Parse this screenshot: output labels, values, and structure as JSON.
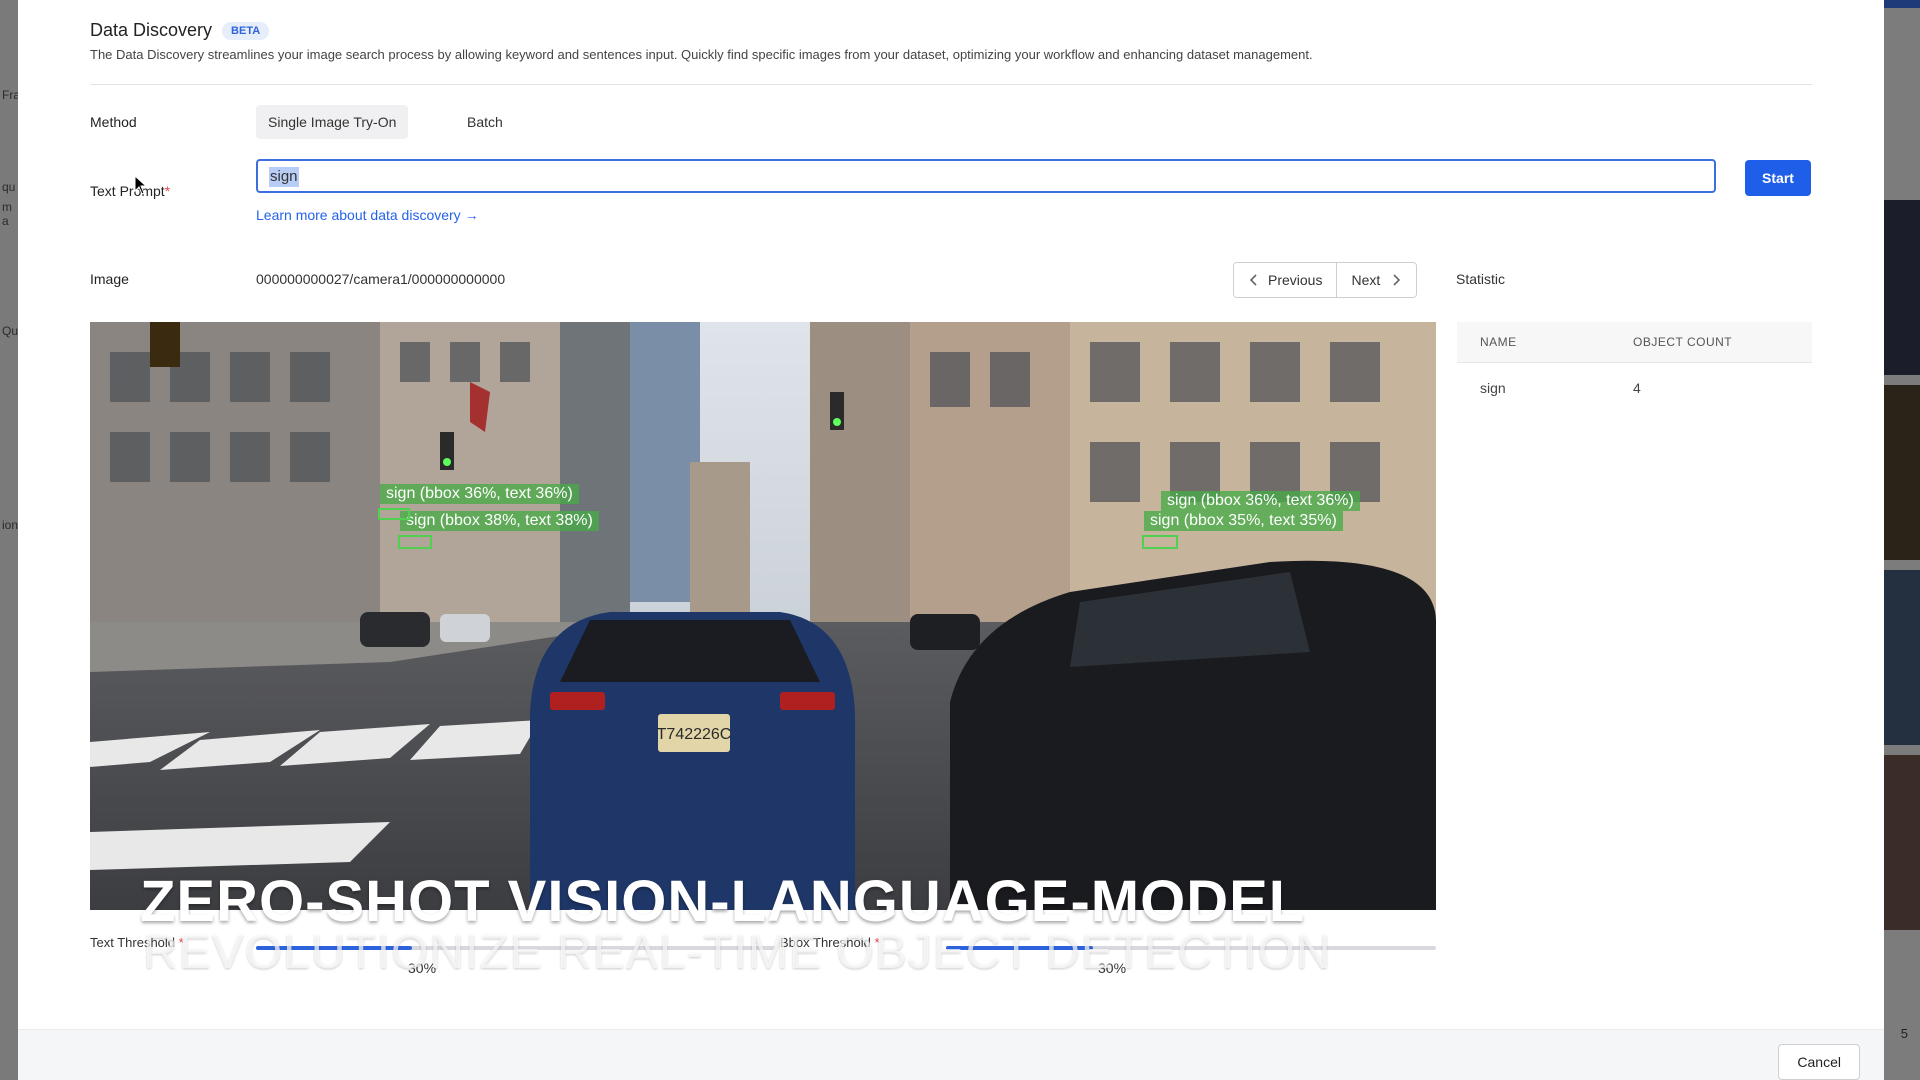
{
  "background": {
    "left_fragments": [
      "Fra",
      "qu",
      "m a",
      "Qua",
      "ion"
    ],
    "right_fragments": [
      "5"
    ]
  },
  "modal": {
    "title": "Data Discovery",
    "badge": "BETA",
    "description": "The Data Discovery streamlines your image search process by allowing keyword and sentences input. Quickly find specific images from your dataset, optimizing your workflow and enhancing dataset management.",
    "method": {
      "label": "Method",
      "options": [
        "Single Image Try-On",
        "Batch"
      ],
      "selected": "Single Image Try-On"
    },
    "text_prompt": {
      "label": "Text Prompt",
      "required_mark": "*",
      "value": "sign"
    },
    "start_label": "Start",
    "learn_more": "Learn more about data discovery →",
    "image": {
      "label": "Image",
      "path": "000000000027/camera1/000000000000"
    },
    "pager": {
      "previous": "Previous",
      "next": "Next"
    },
    "statistic": {
      "label": "Statistic",
      "headers": [
        "NAME",
        "OBJECT COUNT"
      ],
      "rows": [
        {
          "name": "sign",
          "count": "4"
        }
      ]
    },
    "detections": [
      "sign (bbox 36%, text 36%)",
      "sign (bbox 38%, text 38%)",
      "sign (bbox 36%, text 36%)",
      "sign (bbox 35%, text 35%)"
    ],
    "text_threshold": {
      "label": "Text Threshold",
      "required_mark": "*",
      "value": "30%",
      "fraction": 0.3
    },
    "bbox_threshold": {
      "label": "Bbox Threshold",
      "required_mark": "*",
      "value": "30%",
      "fraction": 0.3
    },
    "cancel_label": "Cancel",
    "car_plate": "T742226C"
  },
  "video_overlay": {
    "title": "ZERO-SHOT VISION-LANGUAGE-MODEL",
    "subtitle": "REVOLUTIONIZE REAL-TIME OBJECT DETECTION"
  },
  "colors": {
    "accent": "#1f5ee8",
    "link": "#2563eb",
    "badge_bg": "#e6eefc",
    "detection": "#48aa48",
    "required": "#e5484d"
  }
}
